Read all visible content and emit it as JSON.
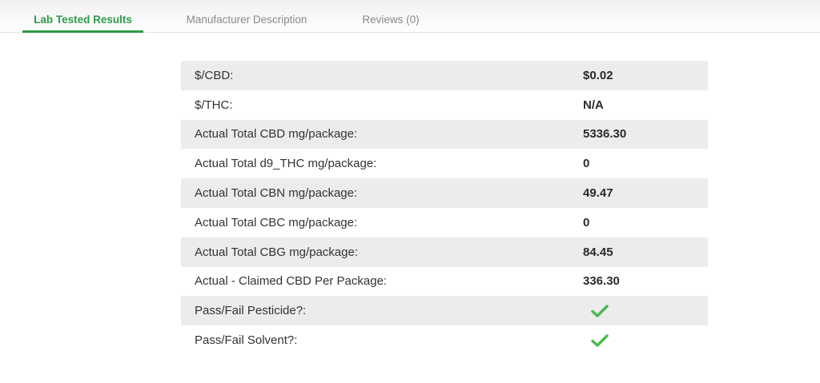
{
  "tabs": [
    {
      "label": "Lab Tested Results",
      "active": true
    },
    {
      "label": "Manufacturer Description",
      "active": false
    },
    {
      "label": "Reviews (0)",
      "active": false
    }
  ],
  "results": {
    "rows": [
      {
        "label": "$/CBD:",
        "value": "$0.02"
      },
      {
        "label": "$/THC:",
        "value": "N/A"
      },
      {
        "label": "Actual Total CBD mg/package:",
        "value": "5336.30"
      },
      {
        "label": "Actual Total d9_THC mg/package:",
        "value": "0"
      },
      {
        "label": "Actual Total CBN mg/package:",
        "value": "49.47"
      },
      {
        "label": "Actual Total CBC mg/package:",
        "value": "0"
      },
      {
        "label": "Actual Total CBG mg/package:",
        "value": "84.45"
      },
      {
        "label": "Actual - Claimed CBD Per Package:",
        "value": "336.30"
      },
      {
        "label": "Pass/Fail Pesticide?:",
        "icon": "checkmark-icon"
      },
      {
        "label": "Pass/Fail Solvent?:",
        "icon": "checkmark-icon"
      }
    ]
  },
  "colors": {
    "accent": "#2e9a49",
    "check": "#4cb94f",
    "row_alt": "#ececee"
  }
}
